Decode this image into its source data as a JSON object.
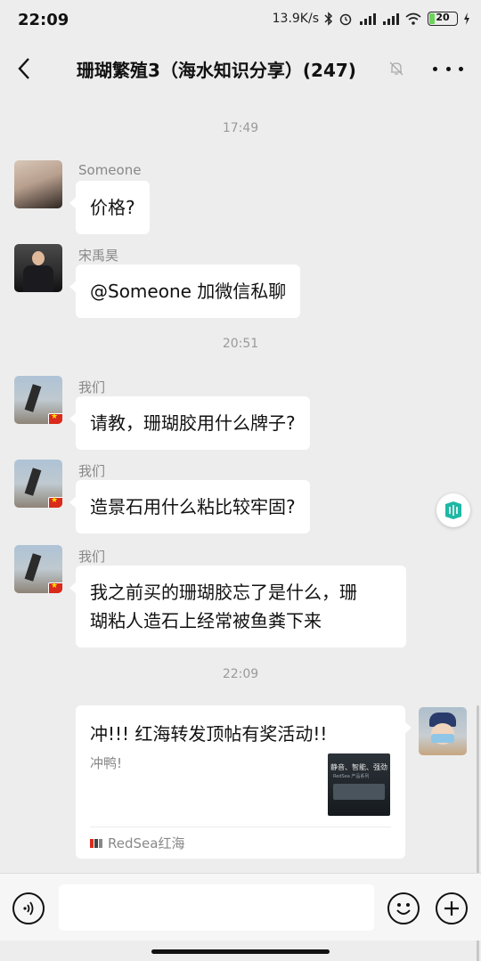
{
  "status_bar": {
    "time": "22:09",
    "network_speed": "13.9K/s",
    "battery": "20"
  },
  "header": {
    "title": "珊瑚繁殖3（海水知识分享）(247)"
  },
  "messages": [
    {
      "time": "17:49",
      "sender": "Someone",
      "text": "价格?"
    },
    {
      "sender": "宋禹昊",
      "text": "@Someone  加微信私聊"
    },
    {
      "time": "20:51",
      "sender": "我们",
      "text": "请教，珊瑚胶用什么牌子?"
    },
    {
      "sender": "我们",
      "text": "造景石用什么粘比较牢固?"
    },
    {
      "sender": "我们",
      "lines": [
        "我之前买的珊瑚胶忘了是什么，珊",
        "瑚粘人造石上经常被鱼粪下来"
      ]
    },
    {
      "time": "22:09"
    }
  ],
  "link_card": {
    "title": "冲!!! 红海转发顶帖有奖活动!!",
    "description": "冲鸭!",
    "thumbnail_caption": "静音、智能、强劲",
    "thumbnail_subcaption": "RedSea 产品系列",
    "source": "RedSea红海"
  },
  "input": {
    "placeholder": ""
  },
  "icons": [
    "back-icon",
    "mute-icon",
    "more-icon",
    "mini-program-icon",
    "voice-icon",
    "emoji-icon",
    "plus-icon"
  ],
  "colors": {
    "background": "#ededed",
    "bubble": "#ffffff",
    "accent": "#1fb8a4"
  }
}
